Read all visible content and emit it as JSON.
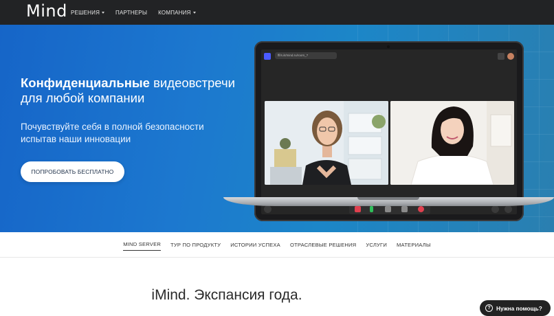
{
  "topnav": {
    "logo": "Mind",
    "items": [
      {
        "label": "РЕШЕНИЯ",
        "has_dropdown": true
      },
      {
        "label": "ПАРТНЕРЫ",
        "has_dropdown": false
      },
      {
        "label": "КОМПАНИЯ",
        "has_dropdown": true
      }
    ]
  },
  "hero": {
    "title_bold": "Конфиденциальные",
    "title_rest": " видеовстречи для любой компании",
    "subtitle": "Почувствуйте себя в полной безопасности испытав наши инновации",
    "cta_label": "ПОПРОБОВАТЬ БЕСПЛАТНО"
  },
  "laptop_app": {
    "url_text": "ffl/s.iit/mind.ru/room_?"
  },
  "subnav": {
    "items": [
      {
        "label": "MIND SERVER",
        "active": true
      },
      {
        "label": "ТУР ПО ПРОДУКТУ",
        "active": false
      },
      {
        "label": "ИСТОРИИ УСПЕХА",
        "active": false
      },
      {
        "label": "ОТРАСЛЕВЫЕ РЕШЕНИЯ",
        "active": false
      },
      {
        "label": "УСЛУГИ",
        "active": false
      },
      {
        "label": "МАТЕРИАЛЫ",
        "active": false
      }
    ]
  },
  "section": {
    "title": "iMind. Экспансия года."
  },
  "help": {
    "label": "Нужна помощь?",
    "icon": "?"
  },
  "colors": {
    "topbar": "#222325",
    "hero_accent": "#1c78cf",
    "record": "#e0404f",
    "mic": "#2fbf5a"
  }
}
